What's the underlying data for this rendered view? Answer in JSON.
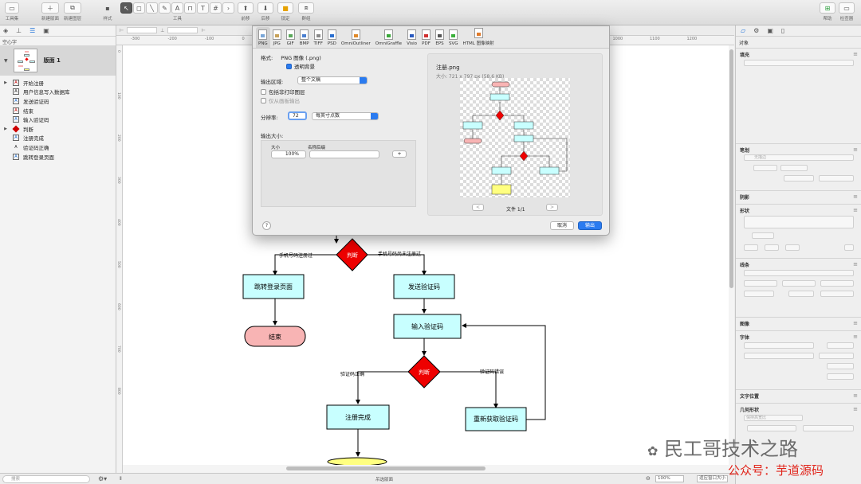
{
  "toolbar": {
    "toolset": "工具集",
    "new_canvas": "新建版面",
    "new_layer": "新建图层",
    "style": "样式",
    "tools": "工具",
    "front": "前移",
    "back": "后移",
    "lock": "锁定",
    "group": "群组",
    "help": "帮助",
    "inspector": "检查器"
  },
  "left": {
    "subtitle": "空心字",
    "canvas_name": "版面 1",
    "layers": [
      "开始注册",
      "用户信息写入数据库",
      "发送验证码",
      "结束",
      "输入验证码",
      "判断",
      "注册完成",
      "验证码正确",
      "跳转登录页面"
    ],
    "search_placeholder": "搜索"
  },
  "ruler": {
    "h": [
      "-300",
      "-200",
      "-100",
      "0",
      "100",
      "200",
      "300",
      "400",
      "500",
      "600",
      "700",
      "800",
      "900",
      "1000",
      "1100",
      "1200"
    ],
    "v": [
      "0",
      "100",
      "200",
      "300",
      "400",
      "500",
      "600",
      "700",
      "800"
    ]
  },
  "flow": {
    "decision1": "判断",
    "branch_registered": "手机号码注册过",
    "branch_not_registered": "手机号码尚未注册过",
    "goto_login": "跳转登录页面",
    "send_code": "发送验证码",
    "end": "结束",
    "input_code": "输入验证码",
    "decision2": "判断",
    "code_correct": "验证码正确",
    "code_wrong": "验证码错误",
    "register_done": "注册完成",
    "refetch_code": "重新获取验证码"
  },
  "dialog": {
    "formats": [
      "PNG",
      "JPG",
      "GIF",
      "BMP",
      "TIFF",
      "PSD",
      "OmniOutliner",
      "OmniGraffle",
      "Visio",
      "PDF",
      "EPS",
      "SVG",
      "HTML 图像映射"
    ],
    "format_label": "格式:",
    "format_value": "PNG 图像 (.png)",
    "transparent_bg": "透明背景",
    "export_area_label": "输出区域:",
    "export_area_value": "整个文稿",
    "include_nonprint": "包括非打印图层",
    "only_canvas": "仅从画板输出",
    "resolution_label": "分辨率:",
    "resolution_value": "72",
    "resolution_unit": "每英寸点数",
    "output_size_label": "输出大小:",
    "size_col": "大小",
    "suffix_col": "名称后缀",
    "size_value": "100%",
    "add": "+",
    "preview_name": "注册.png",
    "preview_info": "大小: 721 x 797 px (58.6 KB)",
    "page_info": "文件 1/1",
    "prev": "<",
    "next": ">",
    "help": "?",
    "cancel": "取消",
    "export": "输出"
  },
  "inspector": {
    "object": "对象",
    "fill": "填充",
    "stroke": "笔划",
    "no_stroke": "无描边",
    "shadow": "阴影",
    "shape": "形状",
    "lines": "线条",
    "image": "图像",
    "font": "字体",
    "text_position": "文字位置",
    "geometry": "几何形状",
    "aspect": "保持高宽比"
  },
  "status": {
    "center": "吊选版面",
    "zoom": "100%",
    "fit": "适应窗口大小"
  },
  "watermark": {
    "line1": "民工哥技术之路",
    "line2": "公众号：芋道源码"
  },
  "colors": {
    "process_fill": "#c8ffff",
    "terminal_fill": "#f8b4b4",
    "decision_fill": "#ee0000",
    "accent": "#2a7bf0"
  }
}
